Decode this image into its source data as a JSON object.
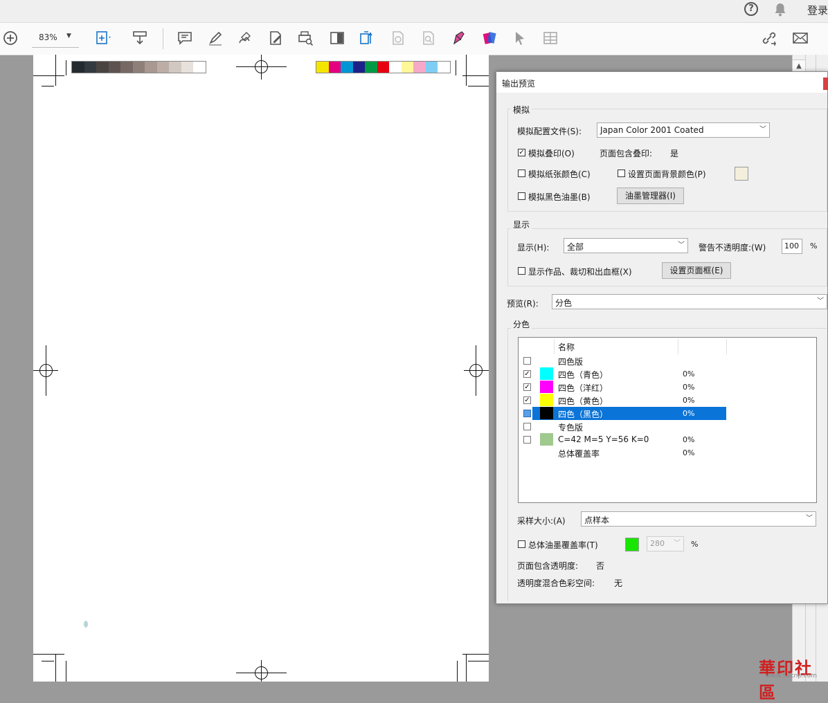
{
  "topbar": {
    "help_icon": "?",
    "login": "登录"
  },
  "toolbar": {
    "zoom": "83%",
    "tools": [
      "zoom-in-icon",
      "fit-page-icon",
      "download-icon",
      "comment-icon",
      "highlight-icon",
      "sign-icon",
      "edit-pdf-icon",
      "print-preview-icon",
      "tint-icon",
      "export-icon",
      "protect-icon",
      "search-doc-icon",
      "fill-sign-icon",
      "color-tool-icon",
      "select-icon",
      "table-icon",
      "share-link-icon",
      "mail-icon"
    ]
  },
  "page": {
    "gray_swatches": [
      "#232b30",
      "#343a3f",
      "#4a4441",
      "#5e5350",
      "#776865",
      "#8f7f79",
      "#a89891",
      "#bcaea7",
      "#d2c8c2",
      "#e7e1dc",
      "#ffffff"
    ],
    "color_swatches": [
      "#f4e500",
      "#e4007f",
      "#0096d6",
      "#1d2088",
      "#009944",
      "#e60012",
      "#ffffff",
      "#fff799",
      "#f5a8c8",
      "#7ecef4",
      "#ffffff"
    ]
  },
  "dialog": {
    "title": "输出预览",
    "simulate": {
      "legend": "模拟",
      "profile_label": "模拟配置文件(S):",
      "profile_value": "Japan Color 2001 Coated",
      "overprint_label": "模拟叠印(O)",
      "overprint_checked": true,
      "page_has_overprint_label": "页面包含叠印:",
      "page_has_overprint_value": "是",
      "paper_color_label": "模拟纸张颜色(C)",
      "bg_color_label": "设置页面背景颜色(P)",
      "bg_color": "#f3efdc",
      "black_ink_label": "模拟黑色油墨(B)",
      "ink_manager_label": "油墨管理器(I)"
    },
    "display": {
      "legend": "显示",
      "show_label": "显示(H):",
      "show_value": "全部",
      "opacity_label": "警告不透明度:(W)",
      "opacity_value": "100",
      "opacity_unit": "%",
      "boxes_label": "显示作品、裁切和出血框(X)",
      "page_boxes_btn": "设置页面框(E)"
    },
    "preview_label": "预览(R):",
    "preview_value": "分色",
    "separations": {
      "legend": "分色",
      "name_header": "名称",
      "rows": [
        {
          "name": "四色版",
          "pct": "",
          "checked": false,
          "color": "",
          "header": true
        },
        {
          "name": "四色（青色）",
          "pct": "0%",
          "checked": true,
          "color": "#00ffff"
        },
        {
          "name": "四色（洋红）",
          "pct": "0%",
          "checked": true,
          "color": "#ff00ff"
        },
        {
          "name": "四色（黄色）",
          "pct": "0%",
          "checked": true,
          "color": "#ffff00"
        },
        {
          "name": "四色（黑色）",
          "pct": "0%",
          "checked": false,
          "color": "#000000",
          "selected": true
        },
        {
          "name": "专色版",
          "pct": "",
          "checked": false,
          "color": "",
          "header": true
        },
        {
          "name": "C=42 M=5 Y=56 K=0",
          "pct": "0%",
          "checked": false,
          "color": "#9fc98e"
        },
        {
          "name": "总体覆盖率",
          "pct": "0%",
          "checked": null,
          "color": ""
        }
      ]
    },
    "sample_label": "采样大小:(A)",
    "sample_value": "点样本",
    "total_ink_label": "总体油墨覆盖率(T)",
    "total_ink_color": "#19e600",
    "total_ink_value": "280",
    "total_ink_unit": "%",
    "transparency_label": "页面包含透明度:",
    "transparency_value": "否",
    "blend_label": "透明度混合色彩空间:",
    "blend_value": "无"
  },
  "watermark": {
    "text": "華印社區",
    "url": "www.52cnp.com"
  }
}
